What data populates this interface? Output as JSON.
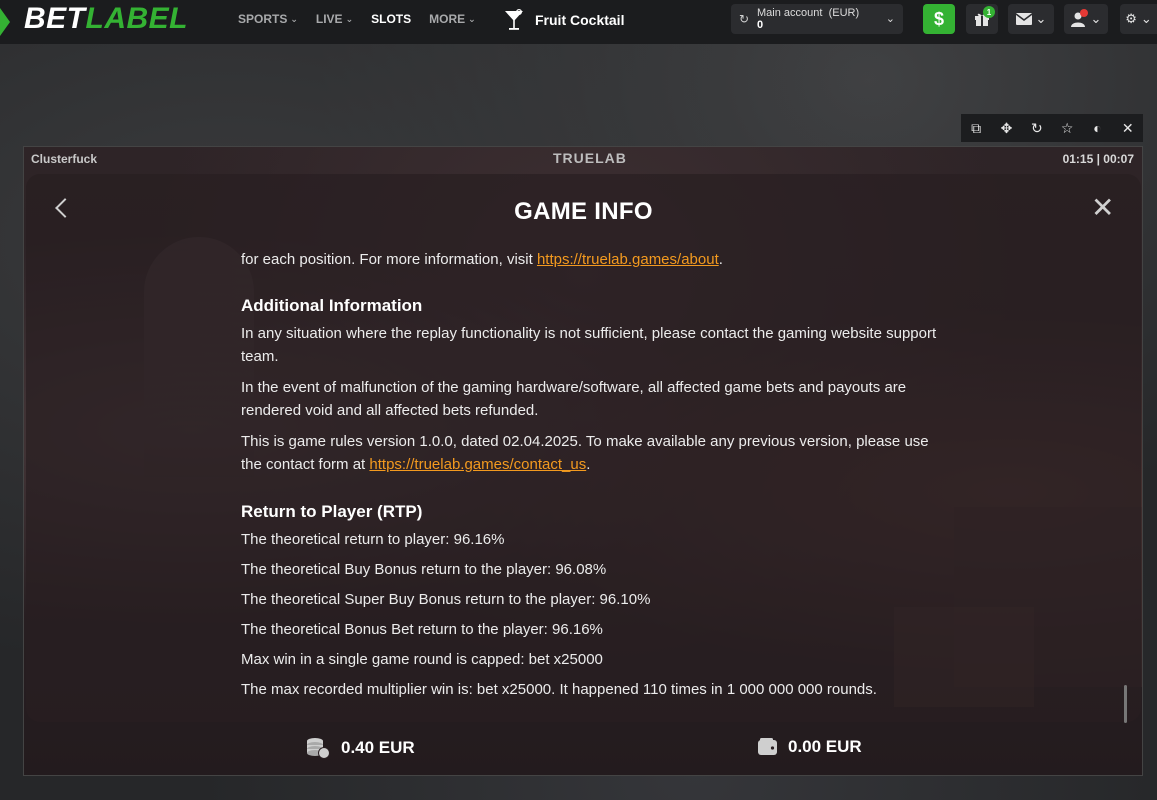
{
  "brand": {
    "logo_bet": "BET",
    "logo_label": "LABEL",
    "accent": "#34b233"
  },
  "nav": {
    "items": [
      {
        "label": "SPORTS",
        "dropdown": true
      },
      {
        "label": "LIVE",
        "dropdown": true
      },
      {
        "label": "SLOTS",
        "dropdown": false
      },
      {
        "label": "MORE",
        "dropdown": true
      }
    ],
    "game_title": "Fruit Cocktail",
    "game_icon": "cocktail-glass-icon"
  },
  "account": {
    "label": "Main account",
    "currency": "(EUR)",
    "balance": "0"
  },
  "header_icons": {
    "deposit": "$",
    "gift_badge": "1"
  },
  "game_toolbar": {
    "icons": [
      "expand-icon",
      "move-icon",
      "reload-icon",
      "star-icon",
      "toggle-icon",
      "close-icon"
    ]
  },
  "game": {
    "name": "Clusterfuck",
    "provider": "TRUELAB",
    "time": "01:15 | 00:07",
    "info": {
      "title": "GAME INFO",
      "intro_text": "for each position. For more information, visit ",
      "intro_link": "https://truelab.games/about",
      "intro_end": ".",
      "additional_heading": "Additional Information",
      "additional_p1": "In any situation where the replay functionality is not sufficient, please contact the gaming website support team.",
      "additional_p2": "In the event of malfunction of the gaming hardware/software, all affected game bets and payouts are rendered void and all affected bets refunded.",
      "additional_p3": "This is game rules version 1.0.0, dated 02.04.2025. To make available any previous version, please use the contact form at ",
      "additional_link": "https://truelab.games/contact_us",
      "additional_end": ".",
      "rtp_heading": "Return to Player (RTP)",
      "rtp_lines": [
        "The theoretical return to player: 96.16%",
        "The theoretical Buy Bonus return to the player: 96.08%",
        "The theoretical Super Buy Bonus return to the player: 96.10%",
        "The theoretical Bonus Bet return to the player: 96.16%",
        "Max win in a single game round is capped: bet x25000",
        "The max recorded multiplier win is: bet x25000. It happened 110 times in 1 000 000 000 rounds."
      ]
    },
    "bet": "0.40 EUR",
    "wallet": "0.00 EUR"
  }
}
